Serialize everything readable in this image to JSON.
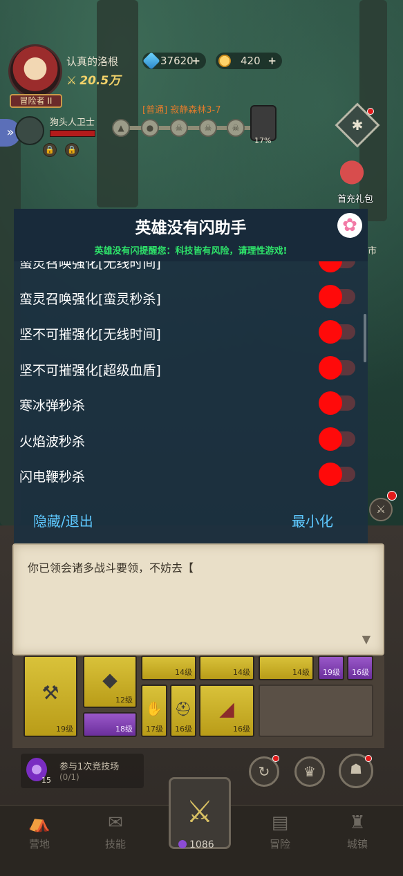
{
  "player": {
    "name": "认真的洛根",
    "power": "20.5万",
    "rank": "冒险者 II"
  },
  "resources": {
    "gems": "37620",
    "coins": "420",
    "plus": "+"
  },
  "enemy": {
    "name": "狗头人卫士"
  },
  "stage": {
    "title": "[普通] 寂静森林3-7",
    "progress": "17%"
  },
  "side": {
    "gift_label": "首充礼包",
    "market_label": "市"
  },
  "assistant": {
    "title": "英雄没有闪助手",
    "warning": "英雄没有闪提醒您：科技皆有风险，请理性游戏!",
    "items": [
      {
        "label": "蛮灵召唤强化[无线时间]",
        "on": false
      },
      {
        "label": "蛮灵召唤强化[蛮灵秒杀]",
        "on": false
      },
      {
        "label": "坚不可摧强化[无线时间]",
        "on": false
      },
      {
        "label": "坚不可摧强化[超级血盾]",
        "on": false
      },
      {
        "label": "寒冰弹秒杀",
        "on": false
      },
      {
        "label": "火焰波秒杀",
        "on": false
      },
      {
        "label": "闪电鞭秒杀",
        "on": false
      }
    ],
    "hide_exit": "隐藏/退出",
    "minimize": "最小化"
  },
  "dialog": {
    "text": "你已领会诸多战斗要领，不妨去【"
  },
  "inventory": {
    "levels": [
      "14级",
      "14级",
      "14级",
      "19级",
      "16级",
      "12级",
      "19级",
      "18级",
      "17级",
      "16级",
      "16级"
    ]
  },
  "quest": {
    "text": "参与1次竞技场",
    "progress": "(0/1)",
    "count": "15"
  },
  "nav": {
    "camp": "营地",
    "skills": "技能",
    "adventure": "冒险",
    "town": "城镇",
    "currency": "1086"
  },
  "colors": {
    "toggle_knob": "#ff0a0a",
    "warning_green": "#2ee36a",
    "link_blue": "#5ec8ff"
  }
}
